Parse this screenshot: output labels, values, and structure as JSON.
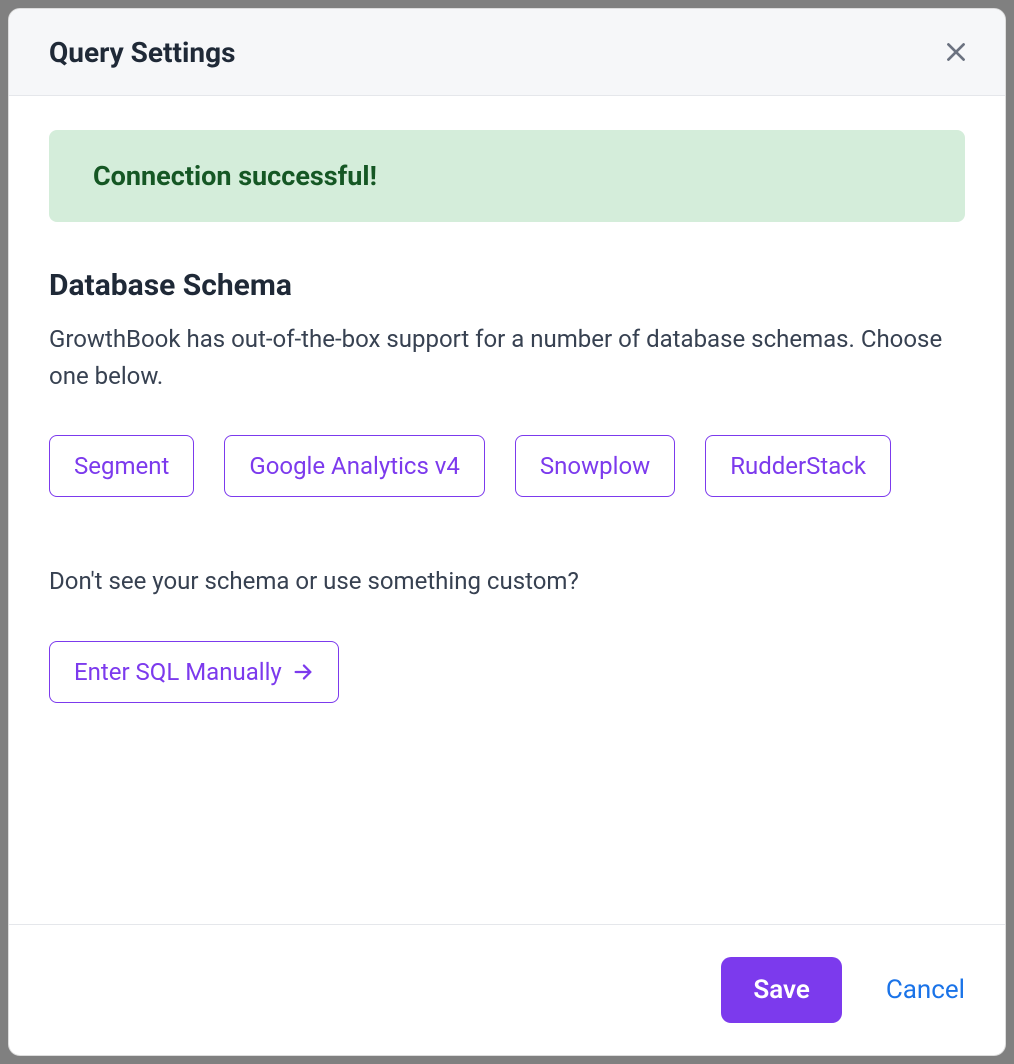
{
  "modal": {
    "title": "Query Settings"
  },
  "alert": {
    "message": "Connection successful!"
  },
  "schema": {
    "heading": "Database Schema",
    "description": "GrowthBook has out-of-the-box support for a number of database schemas. Choose one below.",
    "options": [
      "Segment",
      "Google Analytics v4",
      "Snowplow",
      "RudderStack"
    ],
    "custom_prompt": "Don't see your schema or use something custom?",
    "manual_label": "Enter SQL Manually"
  },
  "footer": {
    "save_label": "Save",
    "cancel_label": "Cancel"
  }
}
